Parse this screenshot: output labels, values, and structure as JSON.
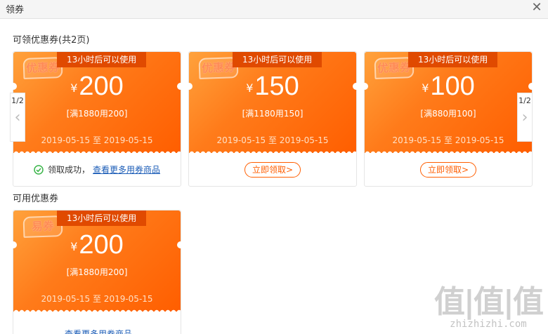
{
  "window": {
    "title": "领券",
    "close_icon": "close-icon"
  },
  "sections": {
    "claimable_title": "可领优惠券(共2页)",
    "usable_title": "可用优惠券"
  },
  "pager": {
    "prev": "1/2",
    "next": "1/2"
  },
  "claimable": [
    {
      "stamp": "优惠券",
      "badge": "13小时后可以使用",
      "currency": "¥",
      "amount": "200",
      "condition": "[满1880用200]",
      "dates": "2019-05-15 至 2019-05-15",
      "status": "领取成功，",
      "link": "查看更多用券商品"
    },
    {
      "stamp": "优惠券",
      "badge": "13小时后可以使用",
      "currency": "¥",
      "amount": "150",
      "condition": "[满1180用150]",
      "dates": "2019-05-15 至 2019-05-15",
      "button": "立即领取>"
    },
    {
      "stamp": "优惠券",
      "badge": "13小时后可以使用",
      "currency": "¥",
      "amount": "100",
      "condition": "[满880用100]",
      "dates": "2019-05-15 至 2019-05-15",
      "button": "立即领取>"
    }
  ],
  "usable": [
    {
      "stamp": "易券",
      "badge": "13小时后可以使用",
      "currency": "¥",
      "amount": "200",
      "condition": "[满1880用200]",
      "dates": "2019-05-15 至 2019-05-15",
      "link": "查看更多用券商品"
    }
  ],
  "watermark": {
    "text": "值|值|值",
    "url": "zhizhizhi.com"
  },
  "colors": {
    "accent": "#ff5e00",
    "badge": "#e04a00",
    "link": "#1b5cb7",
    "success": "#3bb54a"
  }
}
